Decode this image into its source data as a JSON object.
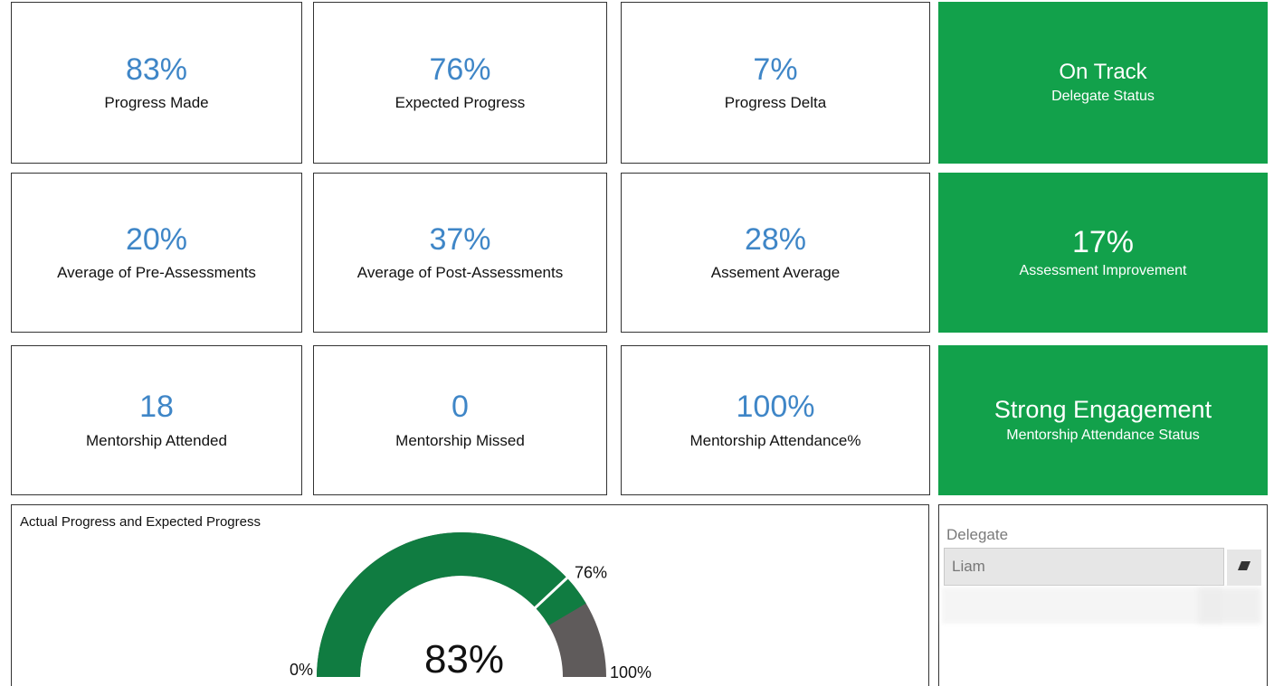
{
  "kpis": [
    {
      "value": "83%",
      "label": "Progress Made"
    },
    {
      "value": "76%",
      "label": "Expected Progress"
    },
    {
      "value": "7%",
      "label": "Progress Delta"
    },
    {
      "value": "On Track",
      "label": "Delegate Status"
    },
    {
      "value": "20%",
      "label": "Average of Pre-Assessments"
    },
    {
      "value": "37%",
      "label": "Average of Post-Assessments"
    },
    {
      "value": "28%",
      "label": "Assement Average"
    },
    {
      "value": "17%",
      "label": "Assessment Improvement"
    },
    {
      "value": "18",
      "label": "Mentorship Attended"
    },
    {
      "value": "0",
      "label": "Mentorship Missed"
    },
    {
      "value": "100%",
      "label": "Mentorship Attendance%"
    },
    {
      "value": "Strong Engagement",
      "label": "Mentorship Attendance Status"
    }
  ],
  "colors": {
    "kpi_value": "#3f86c7",
    "status_green": "#12a14b",
    "gauge_fill": "#107c41",
    "gauge_remaining": "#5f5b5b"
  },
  "gauge": {
    "title": "Actual Progress and Expected Progress",
    "center_label": "83%",
    "min_label": "0%",
    "max_label": "100%",
    "target_label": "76%"
  },
  "chart_data": {
    "type": "gauge",
    "title": "Actual Progress and Expected Progress",
    "value": 83,
    "target": 76,
    "min": 0,
    "max": 100
  },
  "slicer": {
    "label": "Delegate",
    "selected": "Liam",
    "clear_icon": "eraser-icon"
  }
}
